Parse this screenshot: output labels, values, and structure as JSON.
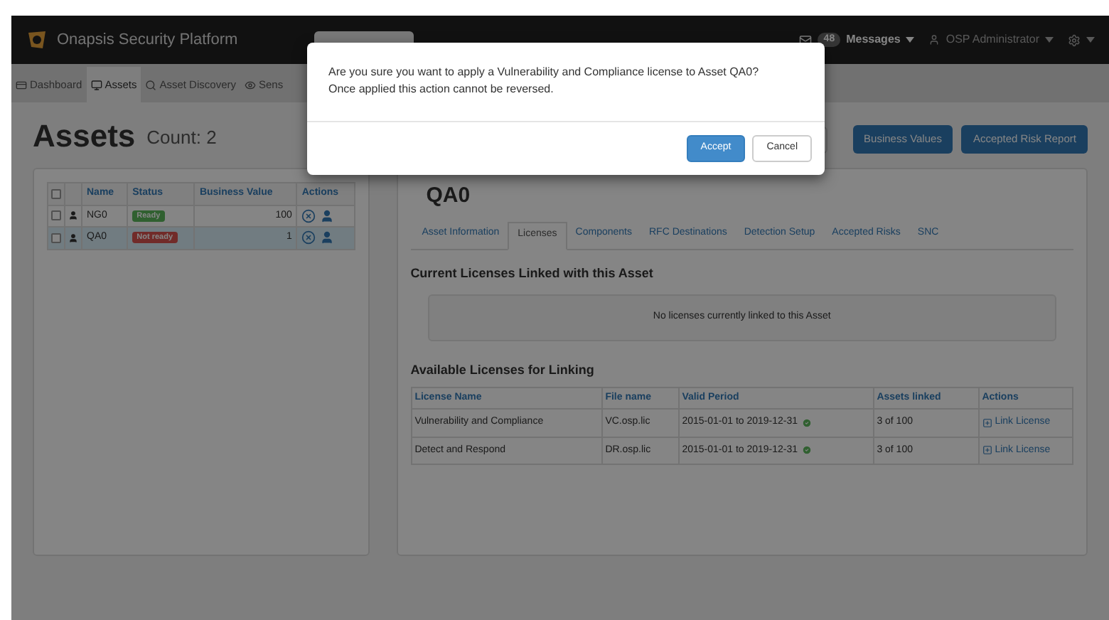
{
  "navbar": {
    "brand": "Onapsis Security Platform",
    "messages_count": "48",
    "messages": "Messages",
    "user": "OSP Administrator"
  },
  "nav_tabs": [
    {
      "label": "Dashboard",
      "kind": "dashboard",
      "selected": false
    },
    {
      "label": "Assets",
      "kind": "monitor",
      "selected": true
    },
    {
      "label": "Asset Discovery",
      "kind": "search",
      "selected": false
    },
    {
      "label": "Sens",
      "kind": "eye",
      "selected": false
    }
  ],
  "page": {
    "title": "Assets",
    "count": "Count: 2"
  },
  "header_buttons": [
    "Business Values",
    "Accepted Risk Report"
  ],
  "assets_table": {
    "select_all_checked": false,
    "columns": [
      "Name",
      "Status",
      "Business Value",
      "Actions"
    ],
    "rows": [
      {
        "checked": false,
        "name": "NG0",
        "status": "Ready",
        "kind": "ok",
        "business_value": "100",
        "selected": false
      },
      {
        "checked": false,
        "name": "QA0",
        "status": "Not ready",
        "kind": "error",
        "business_value": "1",
        "selected": true
      }
    ]
  },
  "detail": {
    "title": "QA0",
    "tabs": [
      {
        "label": "Asset Information",
        "selected": false
      },
      {
        "label": "Licenses",
        "selected": true
      },
      {
        "label": "Components",
        "selected": false
      },
      {
        "label": "RFC Destinations",
        "selected": false
      },
      {
        "label": "Detection Setup",
        "selected": false
      },
      {
        "label": "Accepted Risks",
        "selected": false
      },
      {
        "label": "SNC",
        "selected": false
      }
    ],
    "current_heading": "Current Licenses Linked with this Asset",
    "empty_message": "No licenses currently linked to this Asset",
    "available_heading": "Available Licenses for Linking",
    "columns": [
      "License Name",
      "File name",
      "Valid Period",
      "Assets linked",
      "Actions"
    ],
    "rows": [
      {
        "license_name": "Vulnerability and Compliance",
        "file_name": "VC.osp.lic",
        "valid_period": "2015-01-01 to 2019-12-31",
        "valid": true,
        "assets_linked": "3 of 100",
        "action": "Link License"
      },
      {
        "license_name": "Detect and Respond",
        "file_name": "DR.osp.lic",
        "valid_period": "2015-01-01 to 2019-12-31",
        "valid": true,
        "assets_linked": "3 of 100",
        "action": "Link License"
      }
    ]
  },
  "modal": {
    "message_lines": [
      "Are you sure you want to apply a Vulnerability and Compliance license to Asset QA0?",
      "Once applied this action cannot be reversed."
    ],
    "buttons": [
      {
        "label": "Accept",
        "kind": "primary"
      },
      {
        "label": "Cancel",
        "kind": "default"
      }
    ]
  }
}
